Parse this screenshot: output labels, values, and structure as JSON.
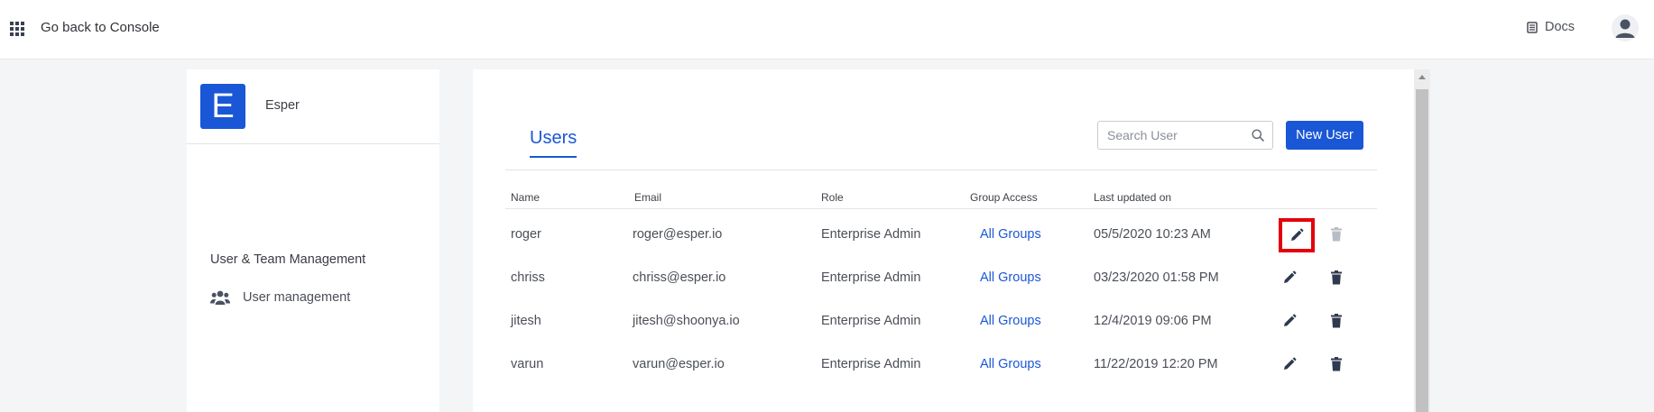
{
  "topbar": {
    "apps_icon": "grid-icon",
    "back_label": "Go back to Console",
    "docs_label": "Docs",
    "docs_icon": "book-icon",
    "avatar_icon": "user-avatar-icon"
  },
  "sidebar": {
    "org_initial": "E",
    "org_name": "Esper",
    "section_title": "User & Team Management",
    "item": {
      "label": "User management",
      "icon": "users-icon"
    }
  },
  "main": {
    "tab_label": "Users",
    "search": {
      "placeholder": "Search User",
      "value": ""
    },
    "new_user_label": "New User",
    "columns": [
      "Name",
      "Email",
      "Role",
      "Group Access",
      "Last updated on"
    ],
    "rows": [
      {
        "name": "roger",
        "email": "roger@esper.io",
        "role": "Enterprise Admin",
        "group": "All Groups",
        "updated": "05/5/2020 10:23 AM"
      },
      {
        "name": "chriss",
        "email": "chriss@esper.io",
        "role": "Enterprise Admin",
        "group": "All Groups",
        "updated": "03/23/2020 01:58 PM"
      },
      {
        "name": "jitesh",
        "email": "jitesh@shoonya.io",
        "role": "Enterprise Admin",
        "group": "All Groups",
        "updated": "12/4/2019 09:06 PM"
      },
      {
        "name": "varun",
        "email": "varun@esper.io",
        "role": "Enterprise Admin",
        "group": "All Groups",
        "updated": "11/22/2019 12:20 PM"
      }
    ]
  },
  "colors": {
    "accent": "#1a57d6",
    "highlight": "#e3000b",
    "disabled_icon": "#b8bcc4",
    "icon": "#2f3a4f"
  }
}
